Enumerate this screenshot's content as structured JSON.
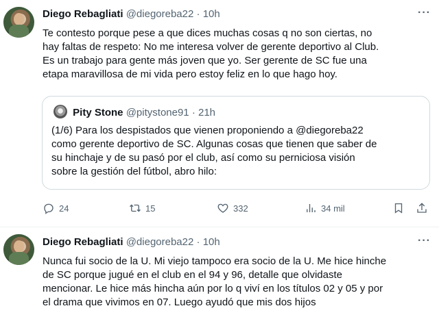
{
  "tweet1": {
    "name": "Diego Rebagliati",
    "handle": "@diegoreba22",
    "dot": "·",
    "time": "10h",
    "more": "···",
    "lines": [
      "Te contesto porque pese a que dices muchas cosas q no son ciertas, no",
      "hay faltas de respeto:  No me interesa volver de gerente deportivo al Club.",
      "Es un trabajo para gente más joven que yo. Ser gerente de SC fue una",
      "etapa maravillosa de mi vida pero estoy feliz en lo que hago hoy."
    ],
    "quote": {
      "name": "Pity Stone",
      "handle": "@pitystone91",
      "dot": "·",
      "time": "21h",
      "lines": [
        "(1/6) Para los despistados que vienen proponiendo a @diegoreba22",
        "como gerente deportivo de SC. Algunas cosas que tienen que saber de",
        "su hinchaje y de su pasó por el club, así como su perniciosa visión",
        "sobre la gestión del fútbol, abro hilo:"
      ]
    },
    "actions": {
      "replies": "24",
      "retweets": "15",
      "likes": "332",
      "views": "34 mil"
    }
  },
  "tweet2": {
    "name": "Diego Rebagliati",
    "handle": "@diegoreba22",
    "dot": "·",
    "time": "10h",
    "more": "···",
    "lines": [
      "Nunca fui socio de la U. Mi viejo tampoco era socio de la U. Me hice hinche",
      "de SC porque jugué en el club en el 94 y 96, detalle que olvidaste",
      "mencionar. Le hice más hincha aún por lo q viví en los títulos 02 y 05 y por",
      "el drama que vivimos en 07. Luego ayudó que mis dos hijos"
    ]
  },
  "colors": {
    "text": "#0f1419",
    "secondary": "#536471",
    "border": "#cfd9de"
  }
}
